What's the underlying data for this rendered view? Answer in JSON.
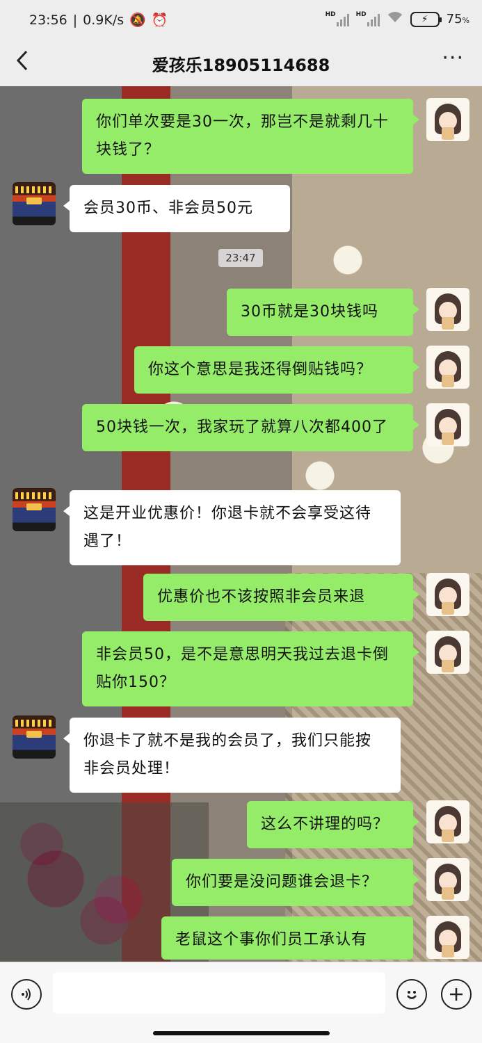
{
  "status_bar": {
    "time": "23:56",
    "net_speed": "0.9K/s",
    "signal_label_1": "HD",
    "signal_label_2": "HD",
    "battery_percent": "75",
    "battery_unit": "%"
  },
  "nav": {
    "back_icon": "chevron-left-icon",
    "title": "爱孩乐18905114688",
    "more_icon": "more-icon"
  },
  "timestamp": "23:47",
  "messages": [
    {
      "side": "sent",
      "text": "你们单次要是30一次，那岂不是就剩几十块钱了？"
    },
    {
      "side": "recv",
      "text": "会员30币、非会员50元"
    },
    {
      "side": "sent",
      "text": "30币就是30块钱吗"
    },
    {
      "side": "sent",
      "text": "你这个意思是我还得倒贴钱吗？"
    },
    {
      "side": "sent",
      "text": "50块钱一次，我家玩了就算八次都400了"
    },
    {
      "side": "recv",
      "text": "这是开业优惠价！你退卡就不会享受这待遇了！"
    },
    {
      "side": "sent",
      "text": "优惠价也不该按照非会员来退"
    },
    {
      "side": "sent",
      "text": "非会员50，是不是意思明天我过去退卡倒贴你150？"
    },
    {
      "side": "recv",
      "text": "你退卡了就不是我的会员了，我们只能按非会员处理！"
    },
    {
      "side": "sent",
      "text": "这么不讲理的吗？"
    },
    {
      "side": "sent",
      "text": "你们要是没问题谁会退卡？"
    },
    {
      "side": "sent",
      "text": "老鼠这个事你们员工承认有"
    }
  ],
  "input_bar": {
    "voice_icon": "voice-icon",
    "emoji_icon": "emoji-icon",
    "plus_icon": "plus-icon"
  },
  "colors": {
    "sent_bubble": "#95ec69",
    "recv_bubble": "#ffffff",
    "bar_bg": "#ededed"
  }
}
